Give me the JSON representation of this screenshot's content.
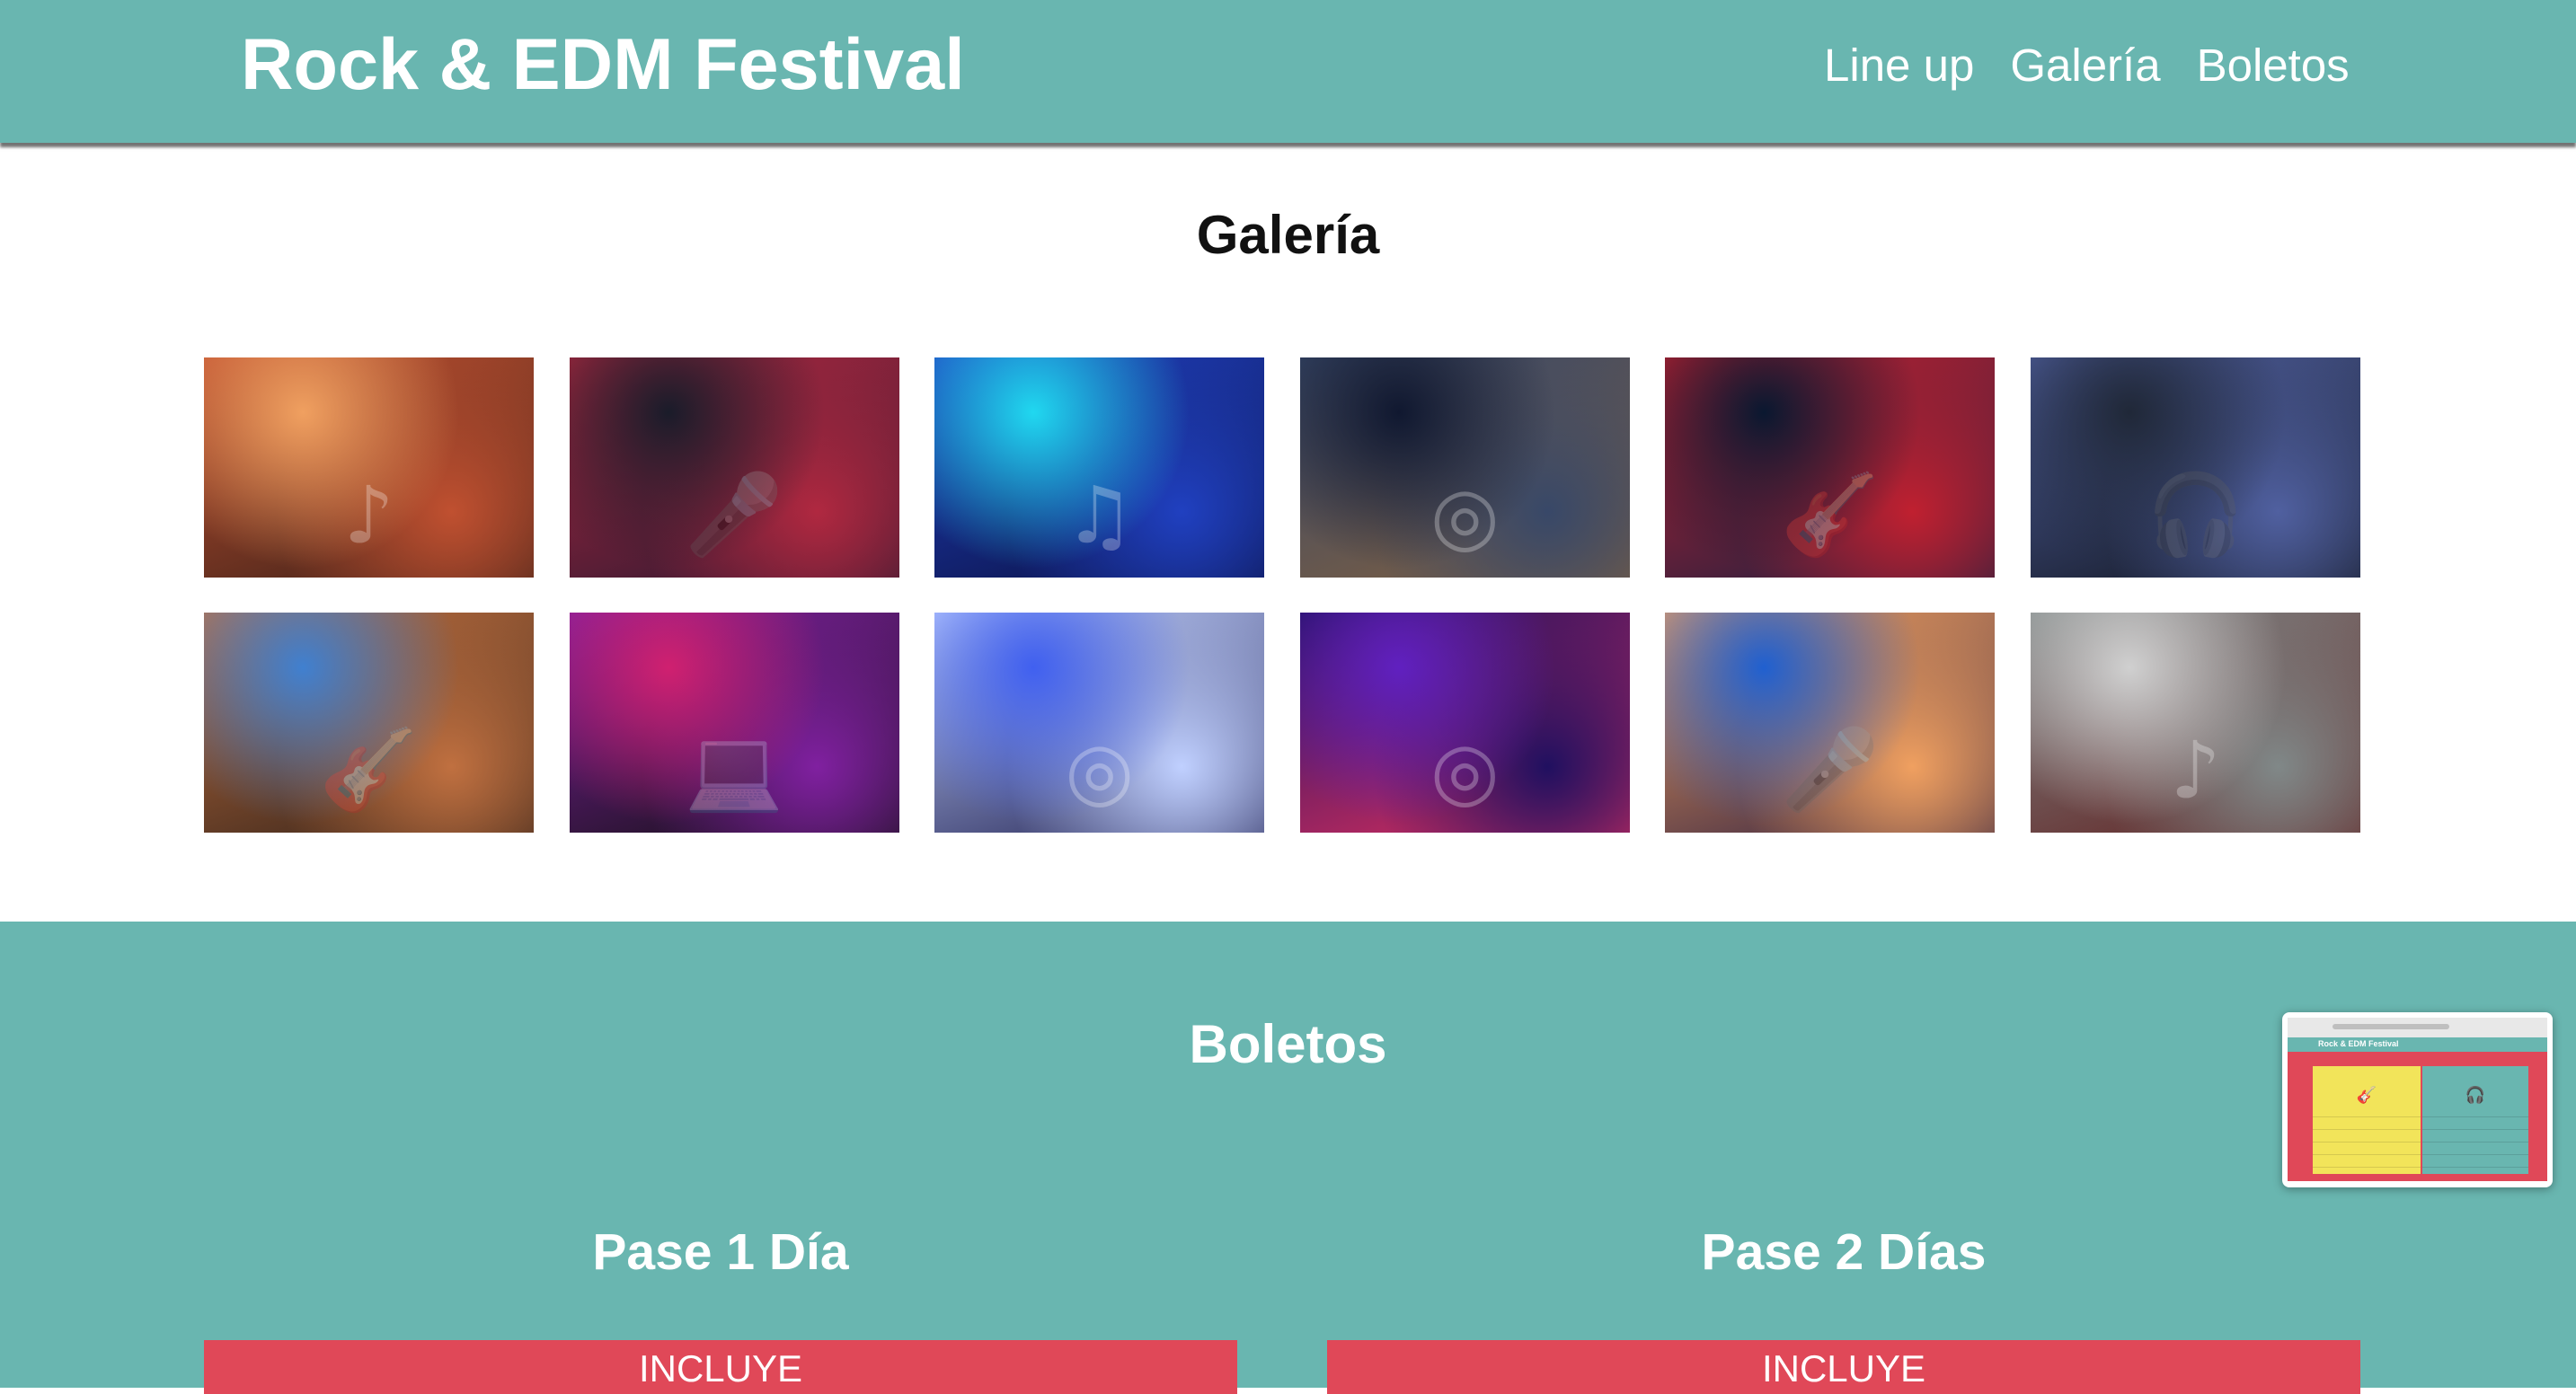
{
  "header": {
    "title": "Rock & EDM Festival",
    "nav": [
      "Line up",
      "Galería",
      "Boletos"
    ]
  },
  "gallery": {
    "title": "Galería",
    "images": [
      {
        "subject": "crowd-concert",
        "icon": "♪",
        "colors": [
          "#f0a060",
          "#c05030",
          "#3a2018"
        ]
      },
      {
        "subject": "rock-singer",
        "icon": "🎤",
        "colors": [
          "#1a1c2a",
          "#b02840",
          "#2a1830"
        ]
      },
      {
        "subject": "edm-crowd-lights",
        "icon": "♫",
        "colors": [
          "#20d8f0",
          "#2040c0",
          "#0a1040"
        ]
      },
      {
        "subject": "dj-turntables",
        "icon": "◎",
        "colors": [
          "#101830",
          "#384868",
          "#806040"
        ]
      },
      {
        "subject": "guitarist-singing",
        "icon": "🎸",
        "colors": [
          "#0a1830",
          "#c02030",
          "#182040"
        ]
      },
      {
        "subject": "female-dj",
        "icon": "🎧",
        "colors": [
          "#202838",
          "#5060a0",
          "#10141c"
        ]
      },
      {
        "subject": "electric-guitars",
        "icon": "🎸",
        "colors": [
          "#4080d0",
          "#c07040",
          "#302018"
        ]
      },
      {
        "subject": "dj-laptop-stage",
        "icon": "💻",
        "colors": [
          "#d02070",
          "#8020a0",
          "#101010"
        ]
      },
      {
        "subject": "dj-mixer-hand",
        "icon": "◎",
        "colors": [
          "#4060f0",
          "#c0d0ff",
          "#202050"
        ]
      },
      {
        "subject": "dj-controller-purple",
        "icon": "◎",
        "colors": [
          "#6020c0",
          "#201060",
          "#e03060"
        ]
      },
      {
        "subject": "rock-duo-singing",
        "icon": "🎤",
        "colors": [
          "#2060d0",
          "#f0a060",
          "#302040"
        ]
      },
      {
        "subject": "performer-smoke",
        "icon": "♪",
        "colors": [
          "#d0d0d0",
          "#808888",
          "#602020"
        ]
      }
    ]
  },
  "tickets": {
    "title": "Boletos",
    "passes": [
      {
        "name": "Pase 1 Día",
        "includes_label": "INCLUYE"
      },
      {
        "name": "Pase 2 Días",
        "includes_label": "INCLUYE"
      }
    ]
  },
  "preview": {
    "title": "Rock & EDM Festival",
    "icon_left": "🎸",
    "icon_right": "🎧"
  },
  "colors": {
    "brand_teal": "#69b6b0",
    "accent_red": "#e04858",
    "text_white": "#ffffff"
  }
}
